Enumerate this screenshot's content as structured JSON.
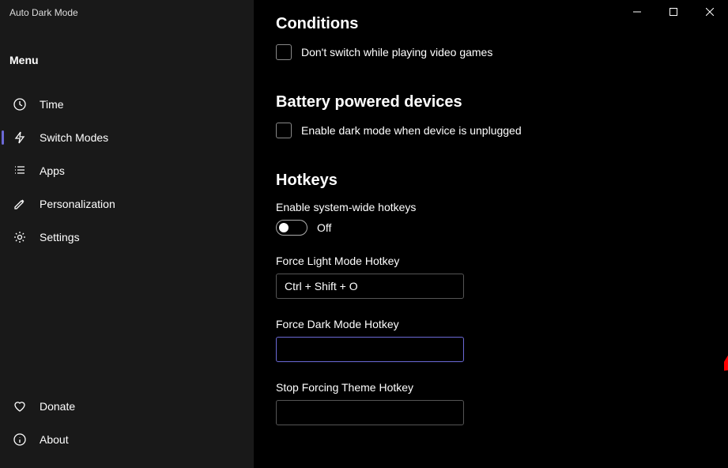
{
  "app": {
    "title": "Auto Dark Mode",
    "menuLabel": "Menu"
  },
  "nav": {
    "time": "Time",
    "switchModes": "Switch Modes",
    "apps": "Apps",
    "personalization": "Personalization",
    "settings": "Settings",
    "donate": "Donate",
    "about": "About"
  },
  "sections": {
    "conditions": {
      "heading": "Conditions",
      "checkbox1": "Don't switch while playing video games"
    },
    "battery": {
      "heading": "Battery powered devices",
      "checkbox1": "Enable dark mode when device is unplugged"
    },
    "hotkeys": {
      "heading": "Hotkeys",
      "enableLabel": "Enable system-wide hotkeys",
      "toggleState": "Off",
      "lightLabel": "Force Light Mode Hotkey",
      "lightValue": "Ctrl + Shift + O",
      "darkLabel": "Force Dark Mode Hotkey",
      "darkValue": "",
      "stopLabel": "Stop Forcing Theme Hotkey",
      "stopValue": ""
    }
  }
}
